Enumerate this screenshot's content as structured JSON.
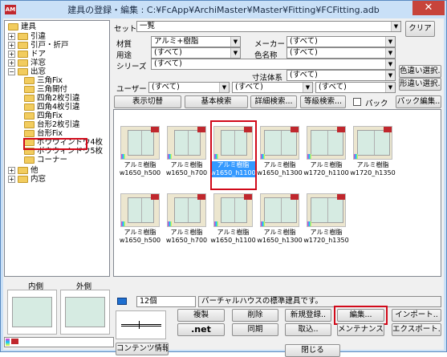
{
  "window": {
    "title": "建具の登録・編集 : C:¥FcApp¥ArchiMaster¥Master¥Fitting¥FCFitting.adb",
    "close_glyph": "✕",
    "app_icon_text": "AM"
  },
  "tree": {
    "root": "建具",
    "items": [
      "引違",
      "引戸・折戸",
      "ドア",
      "洋窓",
      "出窓",
      "三角Fix",
      "三角開付",
      "四角2枚引違",
      "四角4枚引違",
      "四角Fix",
      "台形2枚引違",
      "台形Fix",
      "ボウウィンドウ4枚",
      "ボウウィンドウ5枚",
      "コーナー",
      "他",
      "内窓"
    ]
  },
  "filters": {
    "set_label": "セット",
    "set_value": "一覧",
    "clear_button": "クリア",
    "material_label": "材質",
    "material_value": "アルミ+樹脂",
    "maker_label": "メーカー",
    "maker_value": "(すべて)",
    "usage_label": "用途",
    "usage_value": "(すべて)",
    "color_label": "色名称",
    "color_value": "(すべて)",
    "series_label": "シリーズ",
    "series_value": "(すべて)",
    "dim_label": "寸法体系",
    "dim_value": "(すべて)",
    "color_select_button": "色違い選択..",
    "shape_select_button": "形違い選択..",
    "user_label": "ユーザー",
    "user1": "(すべて)",
    "user2": "(すべて)",
    "user3": "(すべて)"
  },
  "toolbar": {
    "display_toggle": "表示切替",
    "basic_search": "基本検索",
    "detail_search": "詳細検索...",
    "equal_search": "等級検索...",
    "pack_checkbox": "パック",
    "pack_edit": "パック編集.."
  },
  "items": [
    {
      "line1": "アルミ樹脂",
      "line2": "w1650_h500"
    },
    {
      "line1": "アルミ樹脂",
      "line2": "w1650_h700"
    },
    {
      "line1": "アルミ樹脂",
      "line2": "w1650_h1100"
    },
    {
      "line1": "アルミ樹脂",
      "line2": "w1650_h1300"
    },
    {
      "line1": "アルミ樹脂",
      "line2": "w1720_h1100"
    },
    {
      "line1": "アルミ樹脂",
      "line2": "w1720_h1350"
    },
    {
      "line1": "アルミ樹脂",
      "line2": "w1650_h500"
    },
    {
      "line1": "アルミ樹脂",
      "line2": "w1650_h700"
    },
    {
      "line1": "アルミ樹脂",
      "line2": "w1650_h1100"
    },
    {
      "line1": "アルミ樹脂",
      "line2": "w1650_h1300"
    },
    {
      "line1": "アルミ樹脂",
      "line2": "w1720_h1350"
    }
  ],
  "bottom": {
    "inner_label": "内側",
    "outer_label": "外側",
    "count": "12個",
    "description": "バーチャルハウスの標準建具です。",
    "copy_button": "複製",
    "delete_button": "削除",
    "new_button": "新規登録..",
    "edit_button": "編集...",
    "import_button": "インポート..",
    "net_button": ".net",
    "sync_button": "同期",
    "fetch_button": "取込..",
    "maint_button": "メンテナンス..",
    "export_button": "エクスポート..",
    "content_info_button": "コンテンツ情報..",
    "close_button": "閉じる"
  },
  "colors": {
    "selection": "#3399ff",
    "highlight": "#d10a1a",
    "title_bg": "#c9e0f7"
  }
}
